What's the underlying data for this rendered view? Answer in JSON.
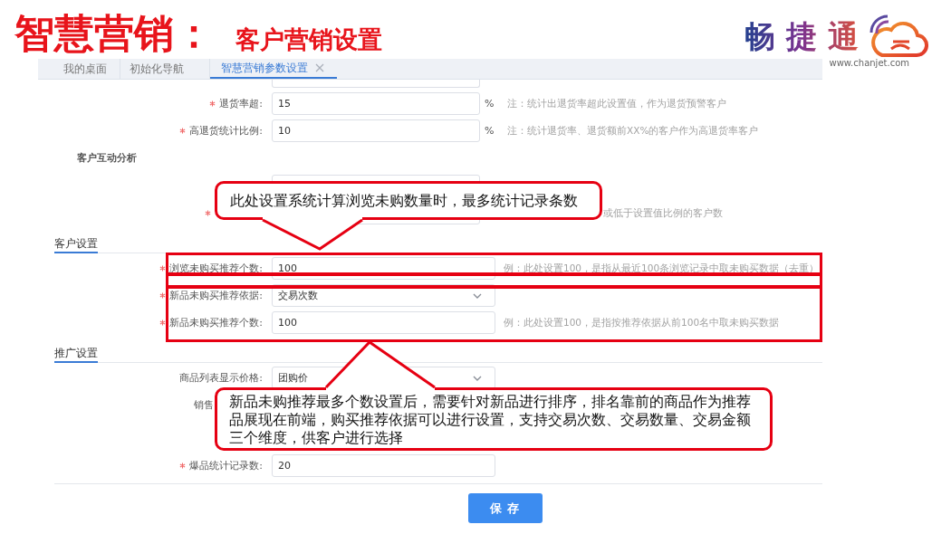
{
  "header": {
    "title": "智慧营销：",
    "subtitle": "客户营销设置"
  },
  "logo": {
    "brand": "畅捷通",
    "url": "www.chanjet.com"
  },
  "tabs": [
    {
      "label": "我的桌面",
      "selected": false,
      "closable": false
    },
    {
      "label": "初始化导航",
      "selected": false,
      "closable": false
    },
    {
      "label": "智慧营销参数设置",
      "selected": true,
      "closable": true
    }
  ],
  "form": [
    {
      "kind": "clipped_input"
    },
    {
      "kind": "input",
      "required": true,
      "label": "退货率超:",
      "value": "15",
      "unit": "%",
      "note": "注：统计出退货率超此设置值，作为退货预警客户"
    },
    {
      "kind": "input",
      "required": true,
      "label": "高退货统计比例:",
      "value": "10",
      "unit": "%",
      "note": "注：统计退货率、退货额前XX%的客户作为高退货率客户"
    },
    {
      "kind": "subheading",
      "label": "客户互动分析"
    },
    {
      "kind": "covered_input",
      "required": false
    },
    {
      "kind": "covered_input",
      "required": true,
      "note": "或低于设置值比例的客户数"
    },
    {
      "kind": "section",
      "label": "客户设置"
    },
    {
      "kind": "input",
      "required": true,
      "label": "浏览未购买推荐个数:",
      "value": "100",
      "note": "例：此处设置100，是指从最近100条浏览记录中取未购买数据（去重）"
    },
    {
      "kind": "select",
      "required": true,
      "label": "新品未购买推荐依据:",
      "value": "交易次数"
    },
    {
      "kind": "input",
      "required": true,
      "label": "新品未购买推荐个数:",
      "value": "100",
      "note": "例：此处设置100，是指按推荐依据从前100名中取未购买数据"
    },
    {
      "kind": "section",
      "label": "推广设置"
    },
    {
      "kind": "select",
      "required": false,
      "label": "商品列表显示价格:",
      "value": "团购价"
    },
    {
      "kind": "covered_label",
      "label": "销售"
    },
    {
      "kind": "input",
      "required": true,
      "label": "爆品统计记录数:",
      "value": "20"
    }
  ],
  "save_button": "保存",
  "callouts": [
    {
      "text": "此处设置系统计算浏览未购数量时，最多统计记录条数"
    },
    {
      "text": "新品未购推荐最多个数设置后，需要针对新品进行排序，排名靠前的商品作为推荐品展现在前端，购买推荐依据可以进行设置，支持交易次数、交易数量、交易金额三个维度，供客户进行选择"
    }
  ]
}
